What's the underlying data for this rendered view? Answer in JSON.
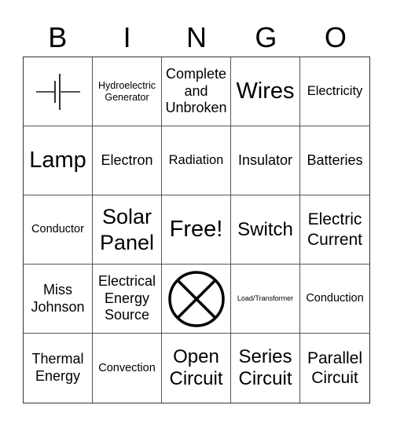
{
  "header": {
    "letters": [
      "B",
      "I",
      "N",
      "G",
      "O"
    ]
  },
  "cells": [
    {
      "type": "icon",
      "icon": "battery-symbol-icon"
    },
    {
      "type": "text",
      "text": "Hydroelectric Generator"
    },
    {
      "type": "text",
      "text": "Complete and Unbroken"
    },
    {
      "type": "text",
      "text": "Wires"
    },
    {
      "type": "text",
      "text": "Electricity"
    },
    {
      "type": "text",
      "text": "Lamp"
    },
    {
      "type": "text",
      "text": "Electron"
    },
    {
      "type": "text",
      "text": "Radiation"
    },
    {
      "type": "text",
      "text": "Insulator"
    },
    {
      "type": "text",
      "text": "Batteries"
    },
    {
      "type": "text",
      "text": "Conductor"
    },
    {
      "type": "text",
      "text": "Solar Panel"
    },
    {
      "type": "text",
      "text": "Free!"
    },
    {
      "type": "text",
      "text": "Switch"
    },
    {
      "type": "text",
      "text": "Electric Current"
    },
    {
      "type": "text",
      "text": "Miss Johnson"
    },
    {
      "type": "text",
      "text": "Electrical Energy Source"
    },
    {
      "type": "icon",
      "icon": "lamp-symbol-icon"
    },
    {
      "type": "text",
      "text": "Load/Transformer"
    },
    {
      "type": "text",
      "text": "Conduction"
    },
    {
      "type": "text",
      "text": "Thermal Energy"
    },
    {
      "type": "text",
      "text": "Convection"
    },
    {
      "type": "text",
      "text": "Open Circuit"
    },
    {
      "type": "text",
      "text": "Series Circuit"
    },
    {
      "type": "text",
      "text": "Parallel Circuit"
    }
  ]
}
